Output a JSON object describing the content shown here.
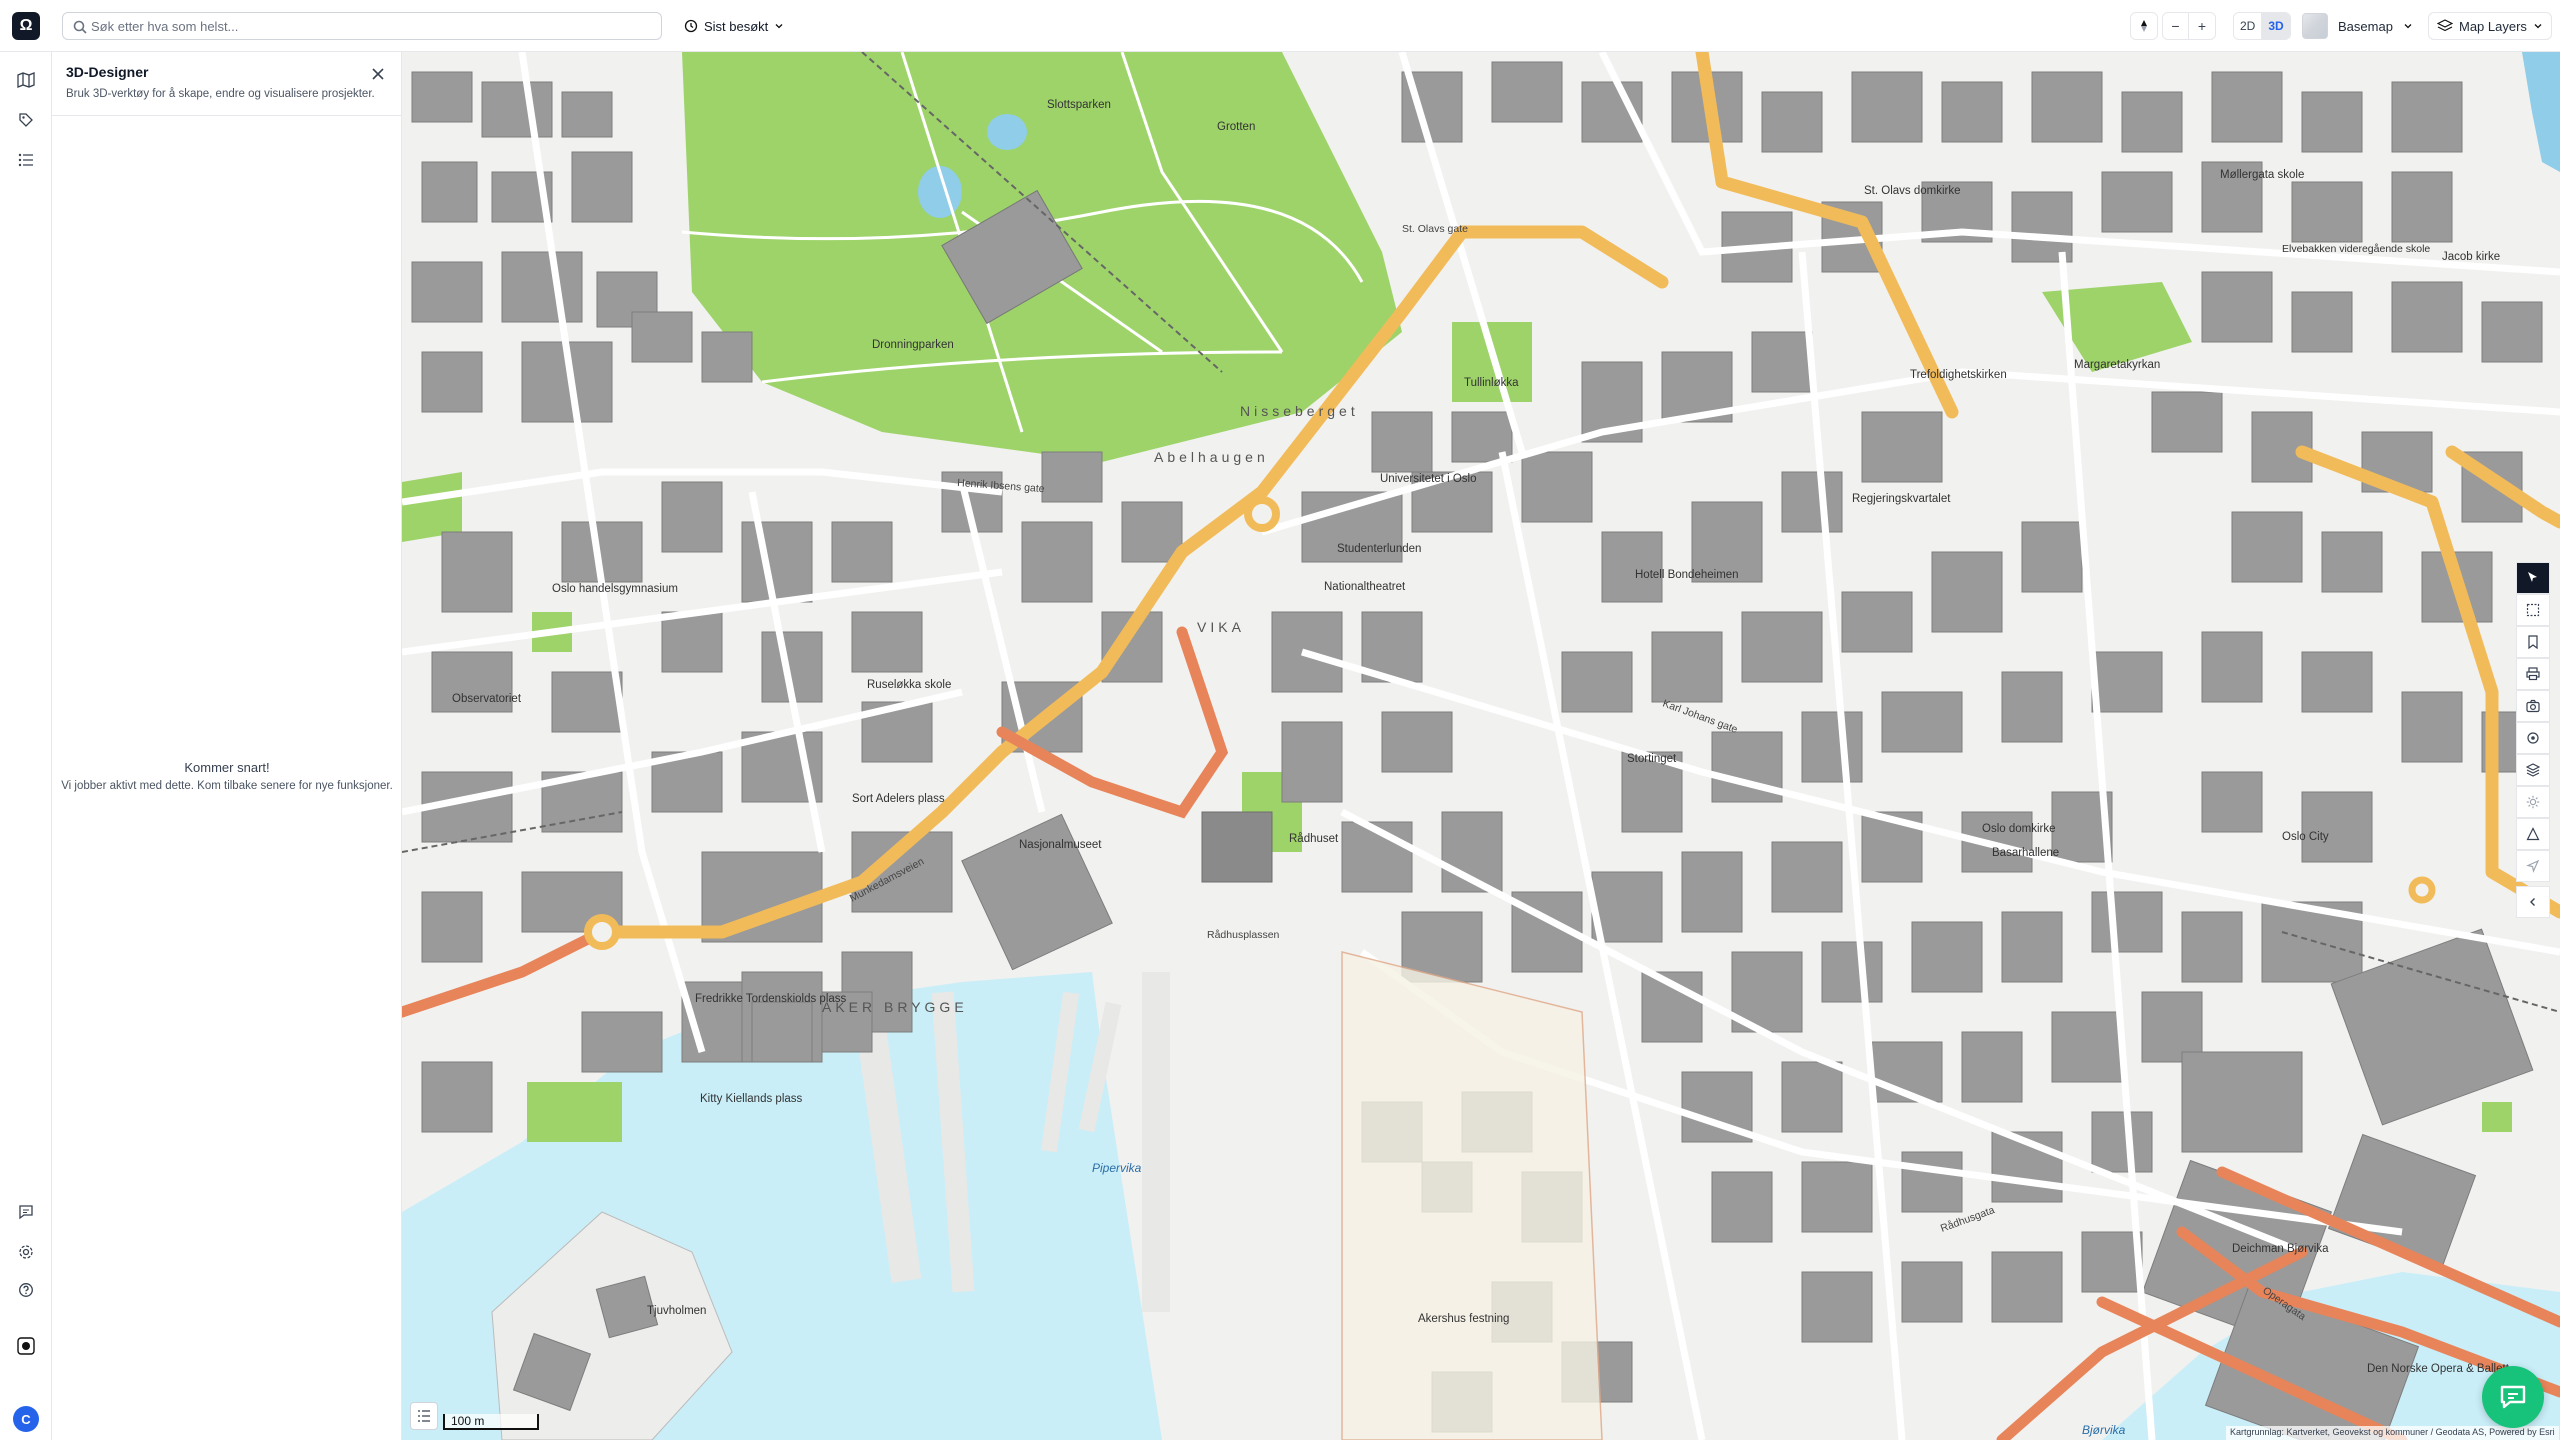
{
  "topbar": {
    "logo": "Ω",
    "search_placeholder": "Søk etter hva som helst...",
    "recent_label": "Sist besøkt",
    "view_2d": "2D",
    "view_3d": "3D",
    "active_view": "3D",
    "zoom_out": "−",
    "zoom_in": "+",
    "basemap_label": "Basemap",
    "layers_label": "Map Layers"
  },
  "rail": {
    "user_initial": "C",
    "icons": [
      "map-icon",
      "tag-icon",
      "list-icon",
      "chat-bubble-icon",
      "settings-icon",
      "help-icon",
      "record-icon"
    ]
  },
  "panel": {
    "title": "3D-Designer",
    "subtitle": "Bruk 3D-verktøy for å skape, endre og visualisere prosjekter.",
    "empty_title": "Kommer snart!",
    "empty_text": "Vi jobber aktivt med dette. Kom tilbake senere for nye funksjoner."
  },
  "map": {
    "scale_label": "100 m",
    "attribution": "Kartgrunnlag: Kartverket, Geovekst og kommuner / Geodata AS, Powered by Esri",
    "colors": {
      "land": "#f1f1ef",
      "building": "#9a9a9a",
      "park": "#9ed36a",
      "water": "#c9eef8",
      "major_road": "#f2bb5a",
      "tram_road": "#e8845a",
      "street": "#ffffff"
    },
    "labels": {
      "slottsparken": "Slottsparken",
      "grotten": "Grotten",
      "dronningparken": "Dronningparken",
      "nisseberget": "Nisseberget",
      "abelhaugen": "Abelhaugen",
      "tullinlokka": "Tullinløkka",
      "universitetet": "Universitetet i Oslo",
      "studenterlunden": "Studenterlunden",
      "nationaltheatret": "Nationaltheatret",
      "vika": "VIKA",
      "oslo_handelsgym": "Oslo handelsgymnasium",
      "observatoriet": "Observatoriet",
      "ruselokka": "Ruseløkka skole",
      "sort_adelers": "Sort Adelers plass",
      "nasjonalmuseet": "Nasjonalmuseet",
      "radhuset": "Rådhuset",
      "radhusplassen": "Rådhusplassen",
      "aker_brygge": "AKER BRYGGE",
      "fred_tordenskiold": "Fredrikke Tordenskiolds plass",
      "kitty_kielland": "Kitty Kiellands plass",
      "tjuvholmen": "Tjuvholmen",
      "pipervika": "Pipervika",
      "akershus": "Akershus festning",
      "regjeringskvartalet": "Regjeringskvartalet",
      "hotell_bondeheimen": "Hotell Bondeheimen",
      "stortinget": "Stortinget",
      "oslo_domkirke": "Oslo domkirke",
      "basarhallene": "Basarhallene",
      "oslo_city": "Oslo City",
      "trefoldighet": "Trefoldighetskirken",
      "margaretakyrkan": "Margaretakyrkan",
      "st_olavs_domkirke": "St. Olavs domkirke",
      "mollergata_skole": "Møllergata skole",
      "elvebakken": "Elvebakken videregående skole",
      "jacob_kirke": "Jacob kirke",
      "deichman": "Deichman Bjørvika",
      "operaen": "Den Norske Opera & Ballett",
      "bjorvika": "Bjørvika",
      "henrik_ibsens_gate": "Henrik Ibsens gate",
      "karl_johans_gate": "Karl Johans gate",
      "st_olavs_gate": "St. Olavs gate",
      "radhusgata": "Rådhusgata",
      "operagata": "Operagata",
      "munkedamsveien": "Munkedamsveien"
    }
  }
}
